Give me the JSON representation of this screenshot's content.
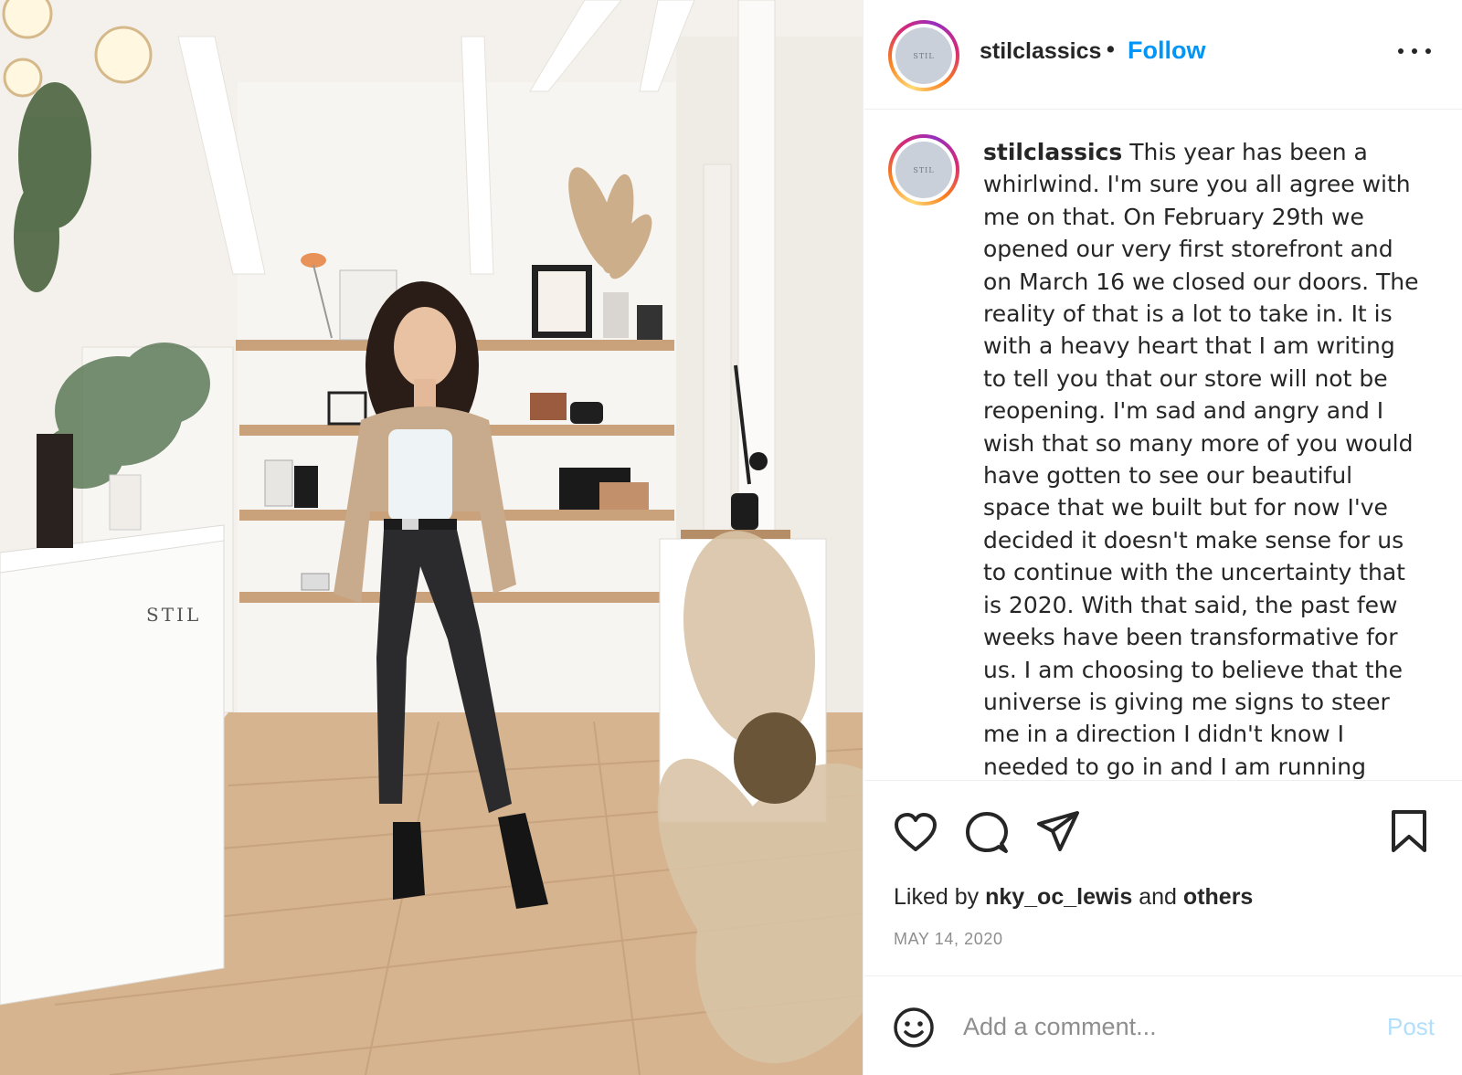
{
  "post": {
    "username": "stilclassics",
    "separator": "•",
    "follow_label": "Follow",
    "avatar_text": "STIL",
    "photo_sign_text": "STIL",
    "caption_username": "stilclassics",
    "caption_text": "This year has been a whirlwind. I'm sure you all agree with me on that. On February 29th we opened our very first storefront and on March 16 we closed our doors. The reality of that is a lot to take in. It is with a heavy heart that I am writing to tell you that our store will not be reopening. I'm sad and angry and I wish that so many more of you would have gotten to see our beautiful space that we built but for now I've decided it doesn't make sense for us to continue with the uncertainty that is 2020. With that said, the past few weeks have been transformative for us. I am choosing to believe that the universe is giving me signs to steer me in a direction I didn't know I needed to go in and I am running",
    "likes": {
      "prefix": "Liked by",
      "user": "nky_oc_lewis",
      "conjunction": "and",
      "others": "others"
    },
    "date": "MAY 14, 2020"
  },
  "actions": {
    "like_icon": "heart-icon",
    "comment_icon": "speech-bubble-icon",
    "share_icon": "paper-plane-icon",
    "save_icon": "bookmark-icon"
  },
  "comment": {
    "placeholder": "Add a comment...",
    "post_label": "Post",
    "emoji_icon": "smiley-icon"
  },
  "colors": {
    "accent": "#0095f6",
    "post_disabled": "#b2dffc",
    "muted": "#8e8e8e",
    "border": "#efefef"
  }
}
